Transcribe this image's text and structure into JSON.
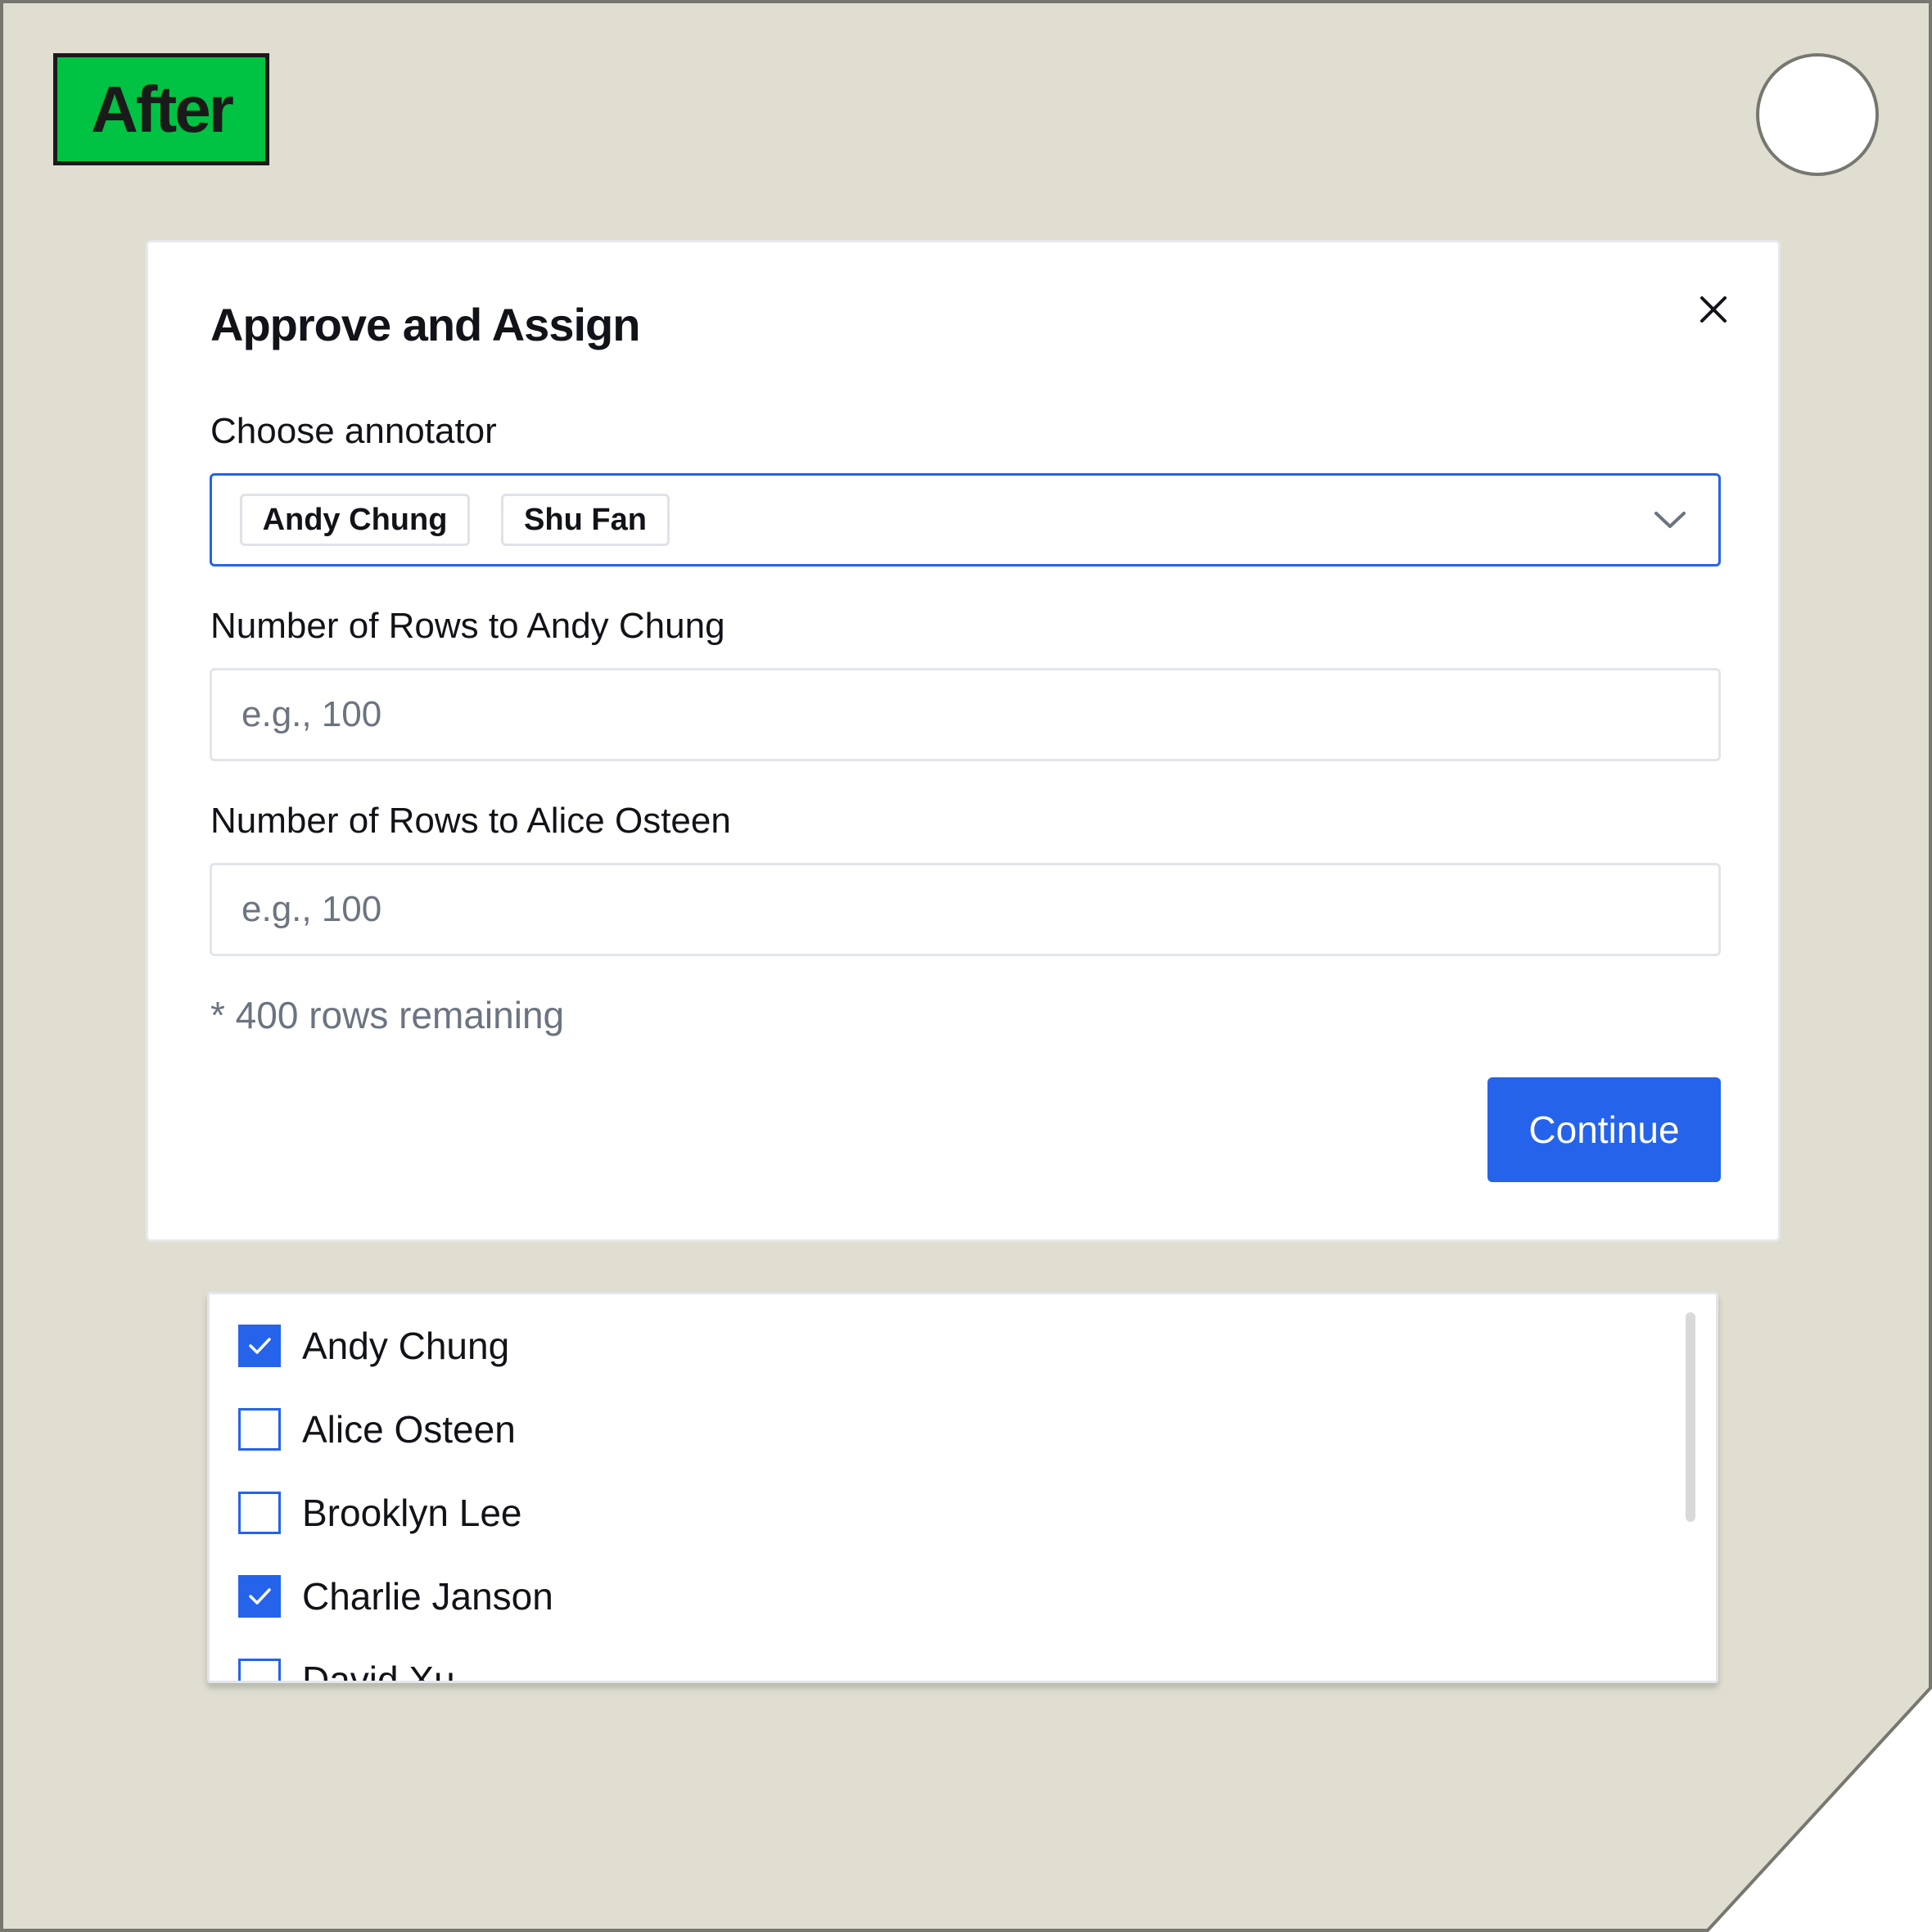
{
  "badge": {
    "label": "After",
    "color": "#00c243"
  },
  "colors": {
    "tag_background": "#dfded1",
    "accent": "#2563eb"
  },
  "modal": {
    "title": "Approve and Assign",
    "close_icon": "close-icon",
    "annotator_label": "Choose annotator",
    "selected_chips": [
      "Andy Chung",
      "Shu Fan"
    ],
    "chevron_icon": "chevron-down-icon",
    "fields": [
      {
        "label": "Number of Rows to Andy Chung",
        "placeholder": "e.g., 100",
        "value": ""
      },
      {
        "label": "Number of Rows to Alice Osteen",
        "placeholder": "e.g., 100",
        "value": ""
      }
    ],
    "remaining_note": "* 400 rows remaining",
    "continue_label": "Continue"
  },
  "dropdown": {
    "options": [
      {
        "label": "Andy Chung",
        "checked": true
      },
      {
        "label": "Alice Osteen",
        "checked": false
      },
      {
        "label": "Brooklyn Lee",
        "checked": false
      },
      {
        "label": "Charlie Janson",
        "checked": true
      },
      {
        "label": "David Xu",
        "checked": false
      }
    ]
  }
}
